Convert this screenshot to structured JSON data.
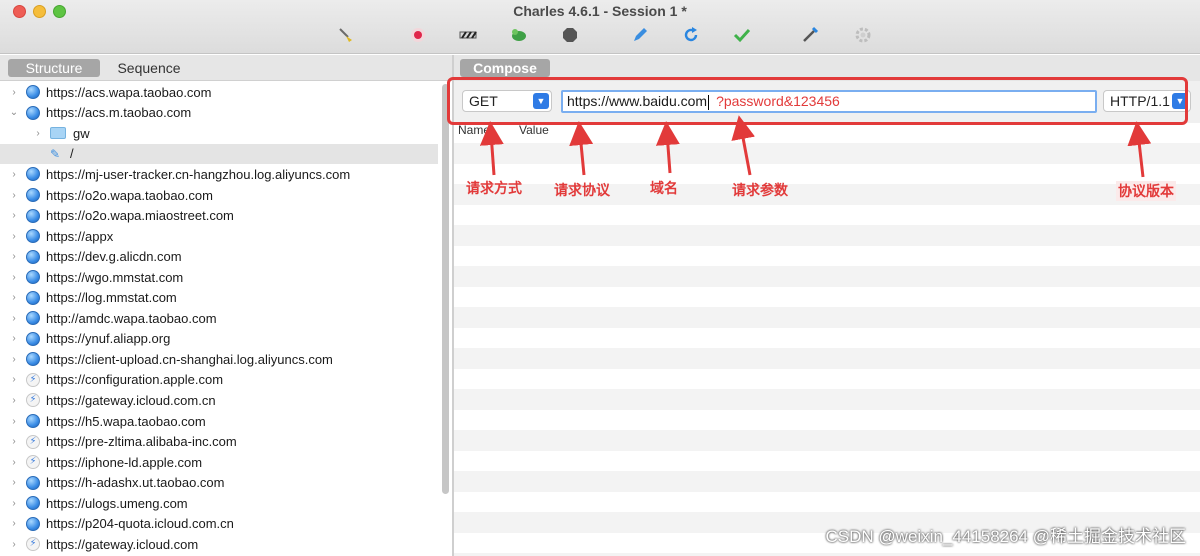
{
  "window": {
    "title": "Charles 4.6.1 - Session 1 *"
  },
  "toolbar": {
    "icons": [
      "broom-icon",
      "record-icon",
      "throttle-icon",
      "turtle-icon",
      "stop-icon",
      "edit-icon",
      "refresh-icon",
      "check-icon",
      "tools-icon",
      "settings-icon"
    ]
  },
  "left_pane": {
    "tabs": [
      {
        "label": "Structure",
        "active": true
      },
      {
        "label": "Sequence",
        "active": false
      }
    ],
    "tree": [
      {
        "label": "https://acs.wapa.taobao.com",
        "icon": "globe-icon",
        "expanded": false,
        "level": 0
      },
      {
        "label": "https://acs.m.taobao.com",
        "icon": "globe-icon",
        "expanded": true,
        "level": 0
      },
      {
        "label": "gw",
        "icon": "folder-icon",
        "expanded": false,
        "level": 1
      },
      {
        "label": "/",
        "icon": "pen-icon",
        "expanded": false,
        "level": 1,
        "selected": true
      },
      {
        "label": "https://mj-user-tracker.cn-hangzhou.log.aliyuncs.com",
        "icon": "globe-icon",
        "expanded": false,
        "level": 0
      },
      {
        "label": "https://o2o.wapa.taobao.com",
        "icon": "globe-icon",
        "expanded": false,
        "level": 0
      },
      {
        "label": "https://o2o.wapa.miaostreet.com",
        "icon": "globe-icon",
        "expanded": false,
        "level": 0
      },
      {
        "label": "https://appx",
        "icon": "globe-icon",
        "expanded": false,
        "level": 0
      },
      {
        "label": "https://dev.g.alicdn.com",
        "icon": "globe-icon",
        "expanded": false,
        "level": 0
      },
      {
        "label": "https://wgo.mmstat.com",
        "icon": "globe-icon",
        "expanded": false,
        "level": 0
      },
      {
        "label": "https://log.mmstat.com",
        "icon": "globe-icon",
        "expanded": false,
        "level": 0
      },
      {
        "label": "http://amdc.wapa.taobao.com",
        "icon": "globe-icon",
        "expanded": false,
        "level": 0
      },
      {
        "label": "https://ynuf.aliapp.org",
        "icon": "globe-icon",
        "expanded": false,
        "level": 0
      },
      {
        "label": "https://client-upload.cn-shanghai.log.aliyuncs.com",
        "icon": "globe-icon",
        "expanded": false,
        "level": 0
      },
      {
        "label": "https://configuration.apple.com",
        "icon": "bolt-icon",
        "expanded": false,
        "level": 0
      },
      {
        "label": "https://gateway.icloud.com.cn",
        "icon": "bolt-icon",
        "expanded": false,
        "level": 0
      },
      {
        "label": "https://h5.wapa.taobao.com",
        "icon": "globe-icon",
        "expanded": false,
        "level": 0
      },
      {
        "label": "https://pre-zltima.alibaba-inc.com",
        "icon": "bolt-icon",
        "expanded": false,
        "level": 0
      },
      {
        "label": "https://iphone-ld.apple.com",
        "icon": "bolt-icon",
        "expanded": false,
        "level": 0
      },
      {
        "label": "https://h-adashx.ut.taobao.com",
        "icon": "globe-icon",
        "expanded": false,
        "level": 0
      },
      {
        "label": "https://ulogs.umeng.com",
        "icon": "globe-icon",
        "expanded": false,
        "level": 0
      },
      {
        "label": "https://p204-quota.icloud.com.cn",
        "icon": "globe-icon",
        "expanded": false,
        "level": 0
      },
      {
        "label": "https://gateway.icloud.com",
        "icon": "bolt-icon",
        "expanded": false,
        "level": 0
      }
    ]
  },
  "compose": {
    "tab_label": "Compose",
    "method": "GET",
    "url_host": "https://www.baidu.com",
    "url_params": "?password&123456",
    "protocol": "HTTP/1.1",
    "columns": {
      "name": "Name",
      "value": "Value"
    }
  },
  "annotations": {
    "method": "请求方式",
    "protocol": "请求协议",
    "domain": "域名",
    "params": "请求参数",
    "version": "协议版本"
  },
  "watermark": "CSDN @weixin_44158264 @稀土掘金技术社区",
  "colors": {
    "annotation": "#e23a3a",
    "accent": "#2f7be5",
    "selection": "#e4e4e4"
  }
}
